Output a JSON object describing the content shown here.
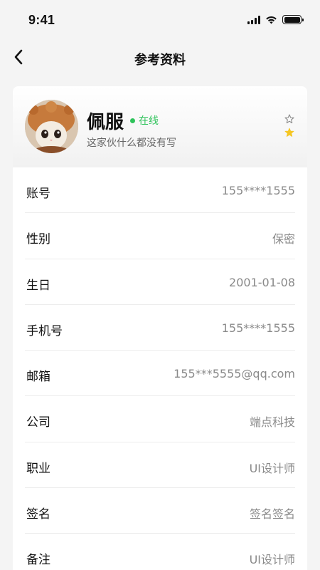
{
  "status_bar": {
    "time": "9:41"
  },
  "nav": {
    "title": "参考资料",
    "back_icon": "chevron-left-icon"
  },
  "profile": {
    "name": "佩服",
    "status": "在线",
    "status_color": "#2fc35b",
    "signature": "这家伙什么都没有写",
    "star_color": "#f5c623"
  },
  "rows": [
    {
      "label": "账号",
      "value": "155****1555"
    },
    {
      "label": "性别",
      "value": "保密"
    },
    {
      "label": "生日",
      "value": "2001-01-08"
    },
    {
      "label": "手机号",
      "value": "155****1555"
    },
    {
      "label": "邮箱",
      "value": "155***5555@qq.com"
    },
    {
      "label": "公司",
      "value": "端点科技"
    },
    {
      "label": "职业",
      "value": "UI设计师"
    },
    {
      "label": "签名",
      "value": "签名签名"
    },
    {
      "label": "备注",
      "value": "UI设计师"
    }
  ]
}
